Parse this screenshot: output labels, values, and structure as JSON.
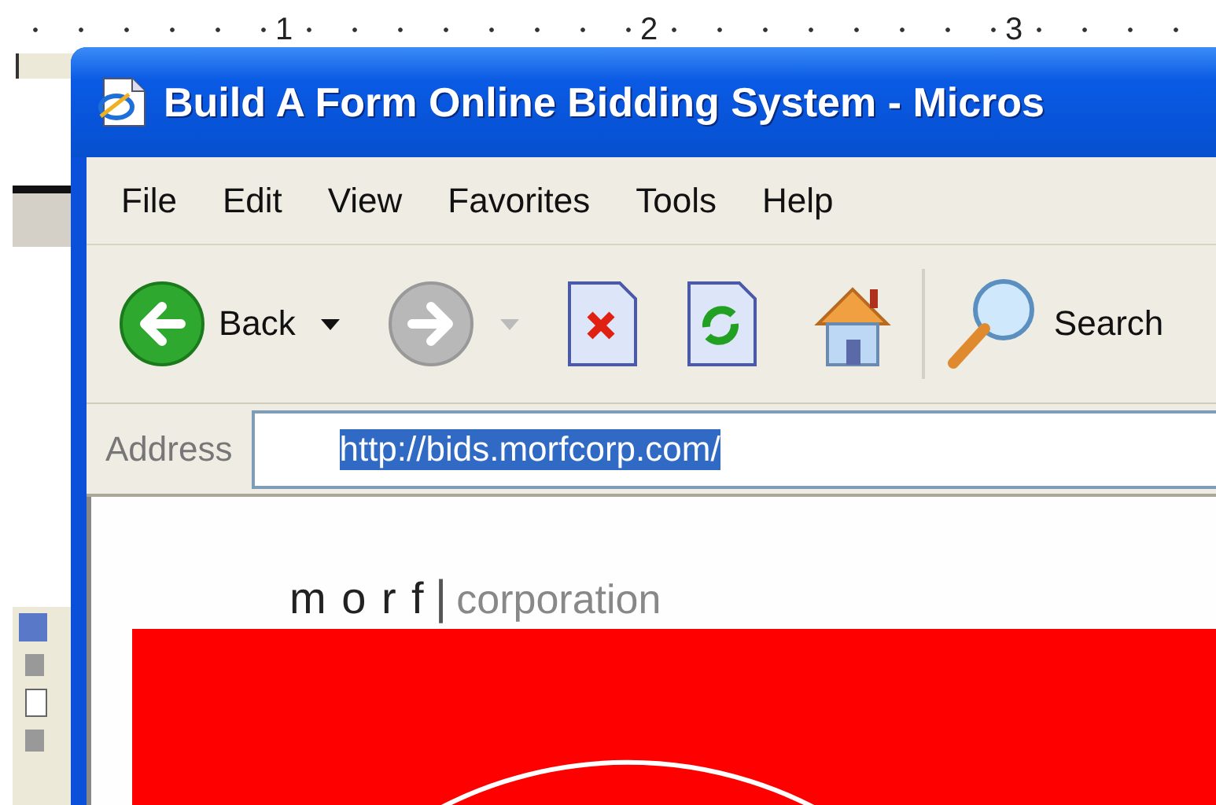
{
  "ruler": {
    "labels": [
      "1",
      "2",
      "3"
    ]
  },
  "browser": {
    "title": "Build A Form Online Bidding System - Micros",
    "menu": [
      "File",
      "Edit",
      "View",
      "Favorites",
      "Tools",
      "Help"
    ],
    "toolbar": [
      {
        "kind": "back",
        "label": "Back",
        "disabled": false
      },
      {
        "kind": "forward",
        "disabled": true
      },
      {
        "kind": "stop"
      },
      {
        "kind": "refresh"
      },
      {
        "kind": "home"
      },
      {
        "kind": "search",
        "label": "Search"
      }
    ],
    "address": {
      "label": "Address",
      "value": "http://bids.morfcorp.com/",
      "selected": true
    },
    "page": {
      "logo_word": "m o r f",
      "logo_divider": "|",
      "logo_suffix": "corporation"
    }
  }
}
